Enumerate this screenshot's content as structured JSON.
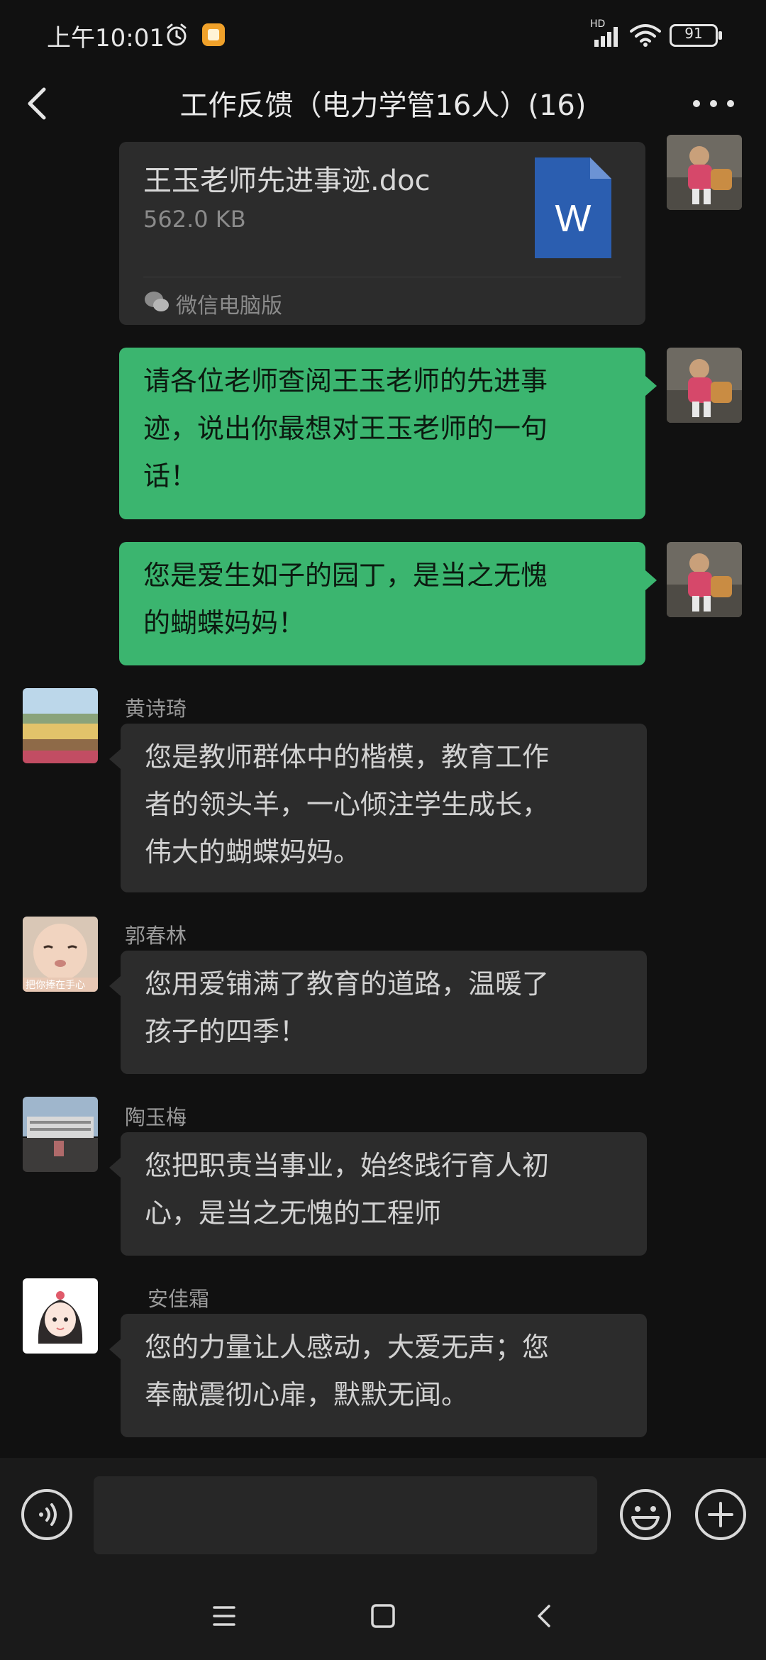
{
  "status_bar": {
    "time": "上午10:01",
    "network_label": "HD",
    "battery_level": "91",
    "icons": [
      "alarm-icon",
      "app-notification-icon",
      "signal-icon",
      "wifi-icon",
      "battery-icon"
    ]
  },
  "nav": {
    "title": "工作反馈（电力学管16人）(16)",
    "back_icon": "chevron-left-icon",
    "more_icon": "more-dots-icon"
  },
  "file_message": {
    "file_name": "王玉老师先进事迹.doc",
    "file_size": "562.0 KB",
    "file_type_letter": "W",
    "source": "微信电脑版"
  },
  "messages": {
    "out1": {
      "lines": [
        "请各位老师查阅王玉老师的先进事",
        "迹，说出你最想对王玉老师的一句",
        "话！"
      ]
    },
    "out2": {
      "lines": [
        "您是爱生如子的园丁，是当之无愧",
        "的蝴蝶妈妈！"
      ]
    },
    "in1": {
      "sender": "黄诗琦",
      "lines": [
        "您是教师群体中的楷模，教育工作",
        "者的领头羊，一心倾注学生成长，",
        "伟大的蝴蝶妈妈。"
      ]
    },
    "in2": {
      "sender": "郭春林",
      "avatar_caption": "把你捧在手心",
      "lines": [
        "您用爱铺满了教育的道路，温暖了",
        "孩子的四季！"
      ]
    },
    "in3": {
      "sender": "陶玉梅",
      "lines": [
        "您把职责当事业，始终践行育人初",
        "心，是当之无愧的工程师"
      ]
    },
    "in4": {
      "sender": "安佳霜",
      "lines": [
        "您的力量让人感动，大爱无声；您",
        "奉献震彻心扉，默默无闻。"
      ]
    }
  },
  "input_bar": {
    "voice_icon": "voice-icon",
    "placeholder": "",
    "emoji_icon": "emoji-icon",
    "plus_icon": "plus-icon"
  },
  "system_nav": {
    "icons": [
      "menu-icon",
      "home-icon",
      "back-icon"
    ]
  },
  "colors": {
    "background": "#111111",
    "bubble_in": "#2c2c2c",
    "bubble_out": "#3bb56f",
    "word_blue": "#2b5eb0"
  }
}
